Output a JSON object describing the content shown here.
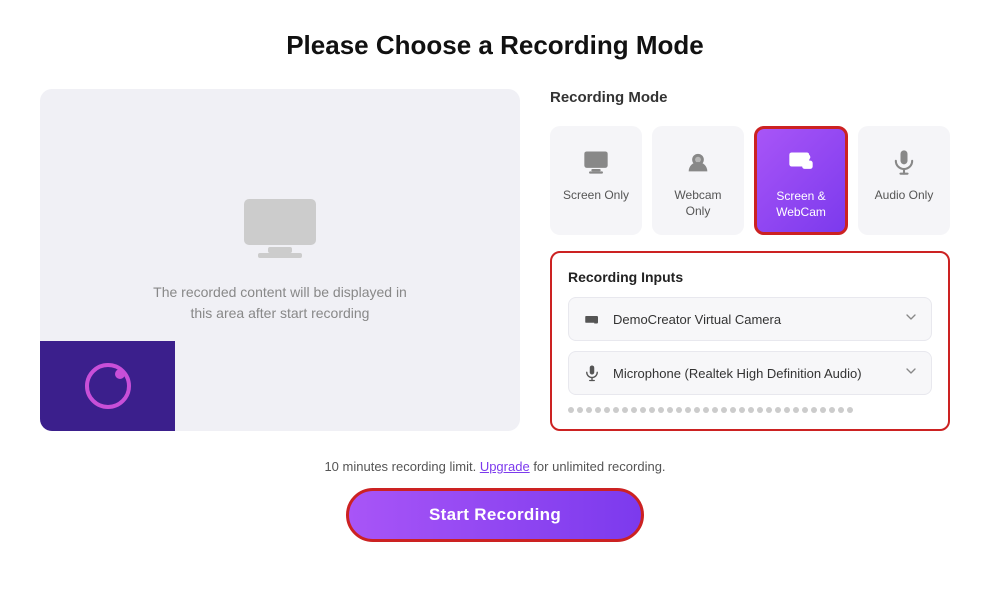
{
  "page": {
    "title": "Please Choose a Recording Mode"
  },
  "recording_mode": {
    "label": "Recording Mode",
    "options": [
      {
        "id": "screen-only",
        "label": "Screen Only",
        "icon": "monitor",
        "active": false
      },
      {
        "id": "webcam-only",
        "label": "Webcam Only",
        "icon": "webcam",
        "active": false
      },
      {
        "id": "screen-webcam",
        "label": "Screen & WebCam",
        "icon": "screen-webcam",
        "active": true
      },
      {
        "id": "audio-only",
        "label": "Audio Only",
        "icon": "microphone",
        "active": false
      }
    ]
  },
  "recording_inputs": {
    "title": "Recording Inputs",
    "camera_device": "DemoCreator Virtual Camera",
    "microphone_device": "Microphone (Realtek High Definition Audio)"
  },
  "preview": {
    "empty_text_line1": "The recorded content will be displayed in",
    "empty_text_line2": "this area after start recording"
  },
  "footer": {
    "limit_text_before": "10 minutes recording limit.",
    "upgrade_label": "Upgrade",
    "limit_text_after": "for unlimited recording.",
    "start_button": "Start Recording"
  }
}
